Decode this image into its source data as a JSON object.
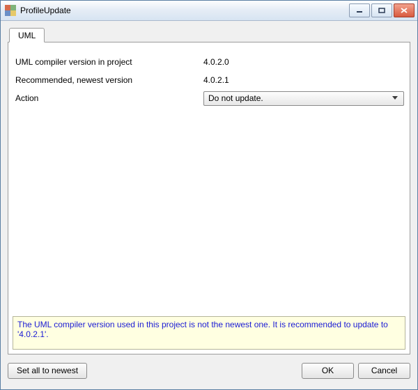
{
  "window": {
    "title": "ProfileUpdate"
  },
  "tabs": [
    {
      "label": "UML"
    }
  ],
  "form": {
    "current_label": "UML compiler version in project",
    "current_value": "4.0.2.0",
    "recommended_label": "Recommended, newest version",
    "recommended_value": "4.0.2.1",
    "action_label": "Action",
    "action_selected": "Do not update."
  },
  "info": "The UML compiler version used in this project is not the newest one. It is recommended to update to '4.0.2.1'.",
  "buttons": {
    "set_all": "Set all to newest",
    "ok": "OK",
    "cancel": "Cancel"
  }
}
